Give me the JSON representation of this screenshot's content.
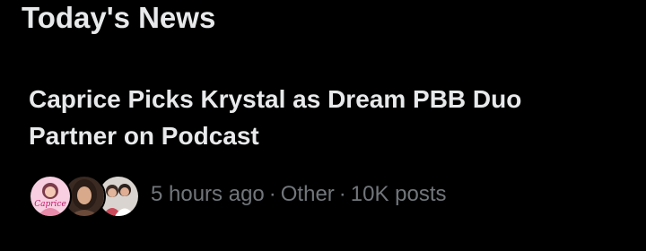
{
  "section": {
    "title": "Today's News"
  },
  "news_item": {
    "headline": "Caprice Picks Krystal as Dream PBB Duo Partner on Podcast",
    "time": "5 hours ago",
    "separator": "·",
    "category": "Other",
    "post_count": "10K posts",
    "avatars": [
      {
        "icon": "avatar-pink-caprice-logo",
        "logo_text": "Caprice"
      },
      {
        "icon": "avatar-woman-portrait"
      },
      {
        "icon": "avatar-two-people-photo"
      }
    ]
  },
  "colors": {
    "background": "#000000",
    "primary_text": "#e7e9ea",
    "secondary_text": "#71767b"
  }
}
